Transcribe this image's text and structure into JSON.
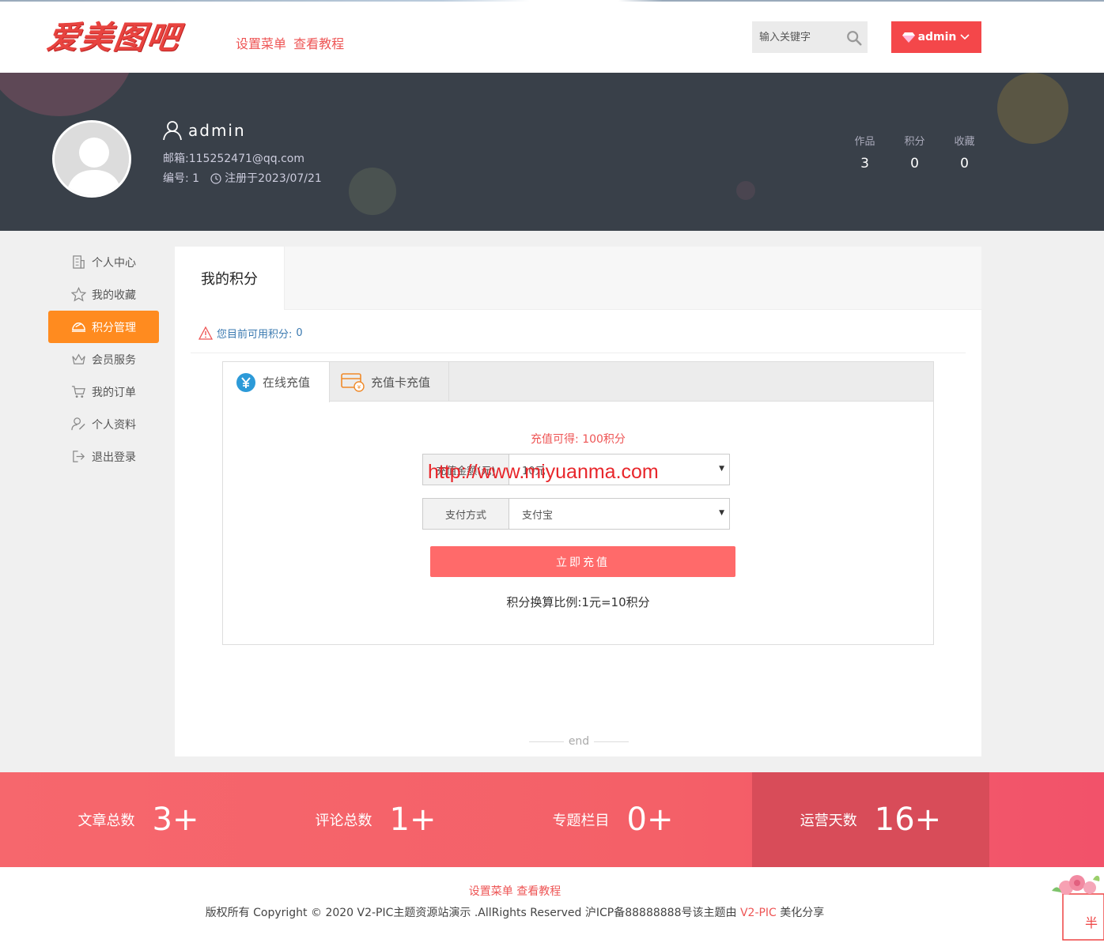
{
  "header": {
    "logo_text": "爱美图吧",
    "menu": [
      "设置菜单",
      "查看教程"
    ],
    "search_placeholder": "输入关键字",
    "user_button": "admin"
  },
  "profile": {
    "name": "admin",
    "email_label": "邮箱:",
    "email": "115252471@qq.com",
    "id_label": "编号:",
    "id": "1",
    "registered": "注册于2023/07/21",
    "stats": [
      {
        "label": "作品",
        "value": "3"
      },
      {
        "label": "积分",
        "value": "0"
      },
      {
        "label": "收藏",
        "value": "0"
      }
    ]
  },
  "sidebar": {
    "items": [
      {
        "label": "个人中心",
        "icon": "building-icon"
      },
      {
        "label": "我的收藏",
        "icon": "star-icon"
      },
      {
        "label": "积分管理",
        "icon": "points-icon"
      },
      {
        "label": "会员服务",
        "icon": "crown-icon"
      },
      {
        "label": "我的订单",
        "icon": "cart-icon"
      },
      {
        "label": "个人资料",
        "icon": "user-edit-icon"
      },
      {
        "label": "退出登录",
        "icon": "logout-icon"
      }
    ],
    "active_index": 2
  },
  "main": {
    "tab": "我的积分",
    "notice_label": "您目前可用积分:",
    "notice_value": "0",
    "recharge_tabs": [
      "在线充值",
      "充值卡充值"
    ],
    "gain_text": "充值可得: 100积分",
    "amount_label": "充值金额(元)",
    "amount_value": "10元",
    "pay_label": "支付方式",
    "pay_value": "支付宝",
    "watermark": "http://www.miyuanma.com",
    "submit": "立即充值",
    "ratio": "积分换算比例:1元=10积分",
    "end": "end"
  },
  "band": [
    {
      "label": "文章总数",
      "value": "3+"
    },
    {
      "label": "评论总数",
      "value": "1+"
    },
    {
      "label": "专题栏目",
      "value": "0+"
    },
    {
      "label": "运营天数",
      "value": "16+"
    }
  ],
  "footer": {
    "menu": "设置菜单 查看教程",
    "copyright_pre": "版权所有 Copyright © 2020 V2-PIC主题资源站演示 .AllRights Reserved 沪ICP备88888888号该主题由 ",
    "copyright_link": "V2-PIC",
    "copyright_post": " 美化分享"
  },
  "colors": {
    "accent": "#f4474a",
    "active": "#ff8b1f",
    "banner": "#394049",
    "band": "#f6676d"
  }
}
